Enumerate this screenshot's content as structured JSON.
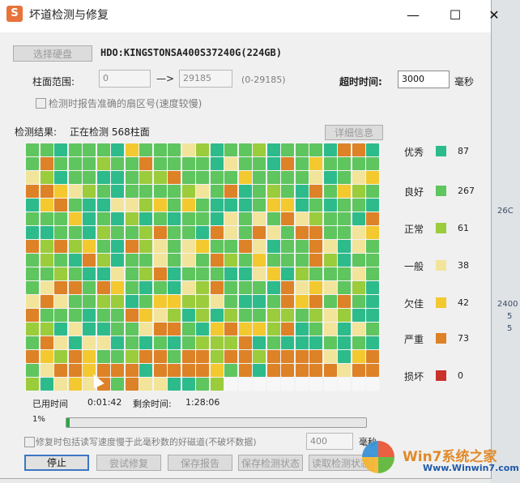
{
  "window": {
    "title": "坏道检测与修复",
    "app_icon": "S"
  },
  "controls": {
    "select_disk": "选择硬盘",
    "disk_name": "HDO:KINGSTONSA400S37240G(224GB)"
  },
  "range": {
    "label": "柱面范围:",
    "start": "0",
    "arrow": "—>",
    "end": "29185",
    "hint": "(0-29185)"
  },
  "timeout": {
    "label": "超时时间:",
    "value": "3000",
    "unit": "毫秒"
  },
  "options": {
    "report_sector": "检测时报告准确的扇区号(速度较慢)",
    "repair_slow": "修复时包括读写速度慢于此毫秒数的好磁道(不破坏数据)",
    "repair_value": "400",
    "repair_unit": "毫秒"
  },
  "status": {
    "label": "检测结果:",
    "text": "正在检测 568柱面",
    "detail_button": "详细信息"
  },
  "legend": [
    {
      "label": "优秀",
      "count": "87",
      "color": "#2dbb8c"
    },
    {
      "label": "良好",
      "count": "267",
      "color": "#5fc55f"
    },
    {
      "label": "正常",
      "count": "61",
      "color": "#9bcc3c"
    },
    {
      "label": "一般",
      "count": "38",
      "color": "#f2e49a"
    },
    {
      "label": "欠佳",
      "count": "42",
      "color": "#f3c92f"
    },
    {
      "label": "严重",
      "count": "73",
      "color": "#dd8226"
    },
    {
      "label": "损坏",
      "count": "0",
      "color": "#c9312b"
    }
  ],
  "time": {
    "used_label": "已用时间",
    "used": "0:01:42",
    "remain_label": "剩余时间:",
    "remain": "1:28:06"
  },
  "progress": {
    "percent_text": "1%",
    "value": 0.01
  },
  "buttons": {
    "stop": "停止",
    "retry": "尝试修复",
    "save_report": "保存报告",
    "save_state": "保存检测状态",
    "load_state": "读取检测状态"
  },
  "watermark": {
    "text": "Win7系统之家",
    "url": "Www.Winwin7.com"
  },
  "background_fragments": [
    "26C",
    "2400",
    "5",
    "5"
  ]
}
